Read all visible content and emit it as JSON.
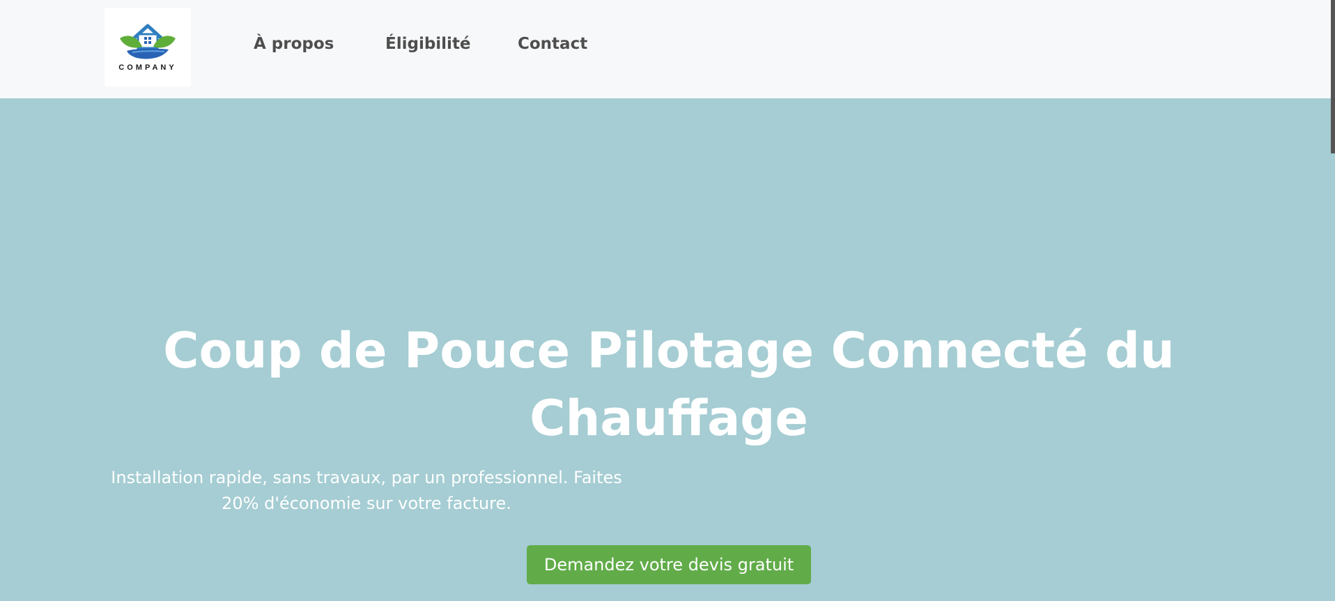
{
  "logo": {
    "text": "COMPANY",
    "icon": "house-leaves-hand-logo",
    "colors": {
      "roof": "#2f7fc0",
      "leaf": "#5fae3a",
      "hand": "#2a63b5"
    }
  },
  "nav": {
    "items": [
      {
        "label": "À propos"
      },
      {
        "label": "Éligibilité"
      },
      {
        "label": "Contact"
      }
    ]
  },
  "hero": {
    "title": "Coup de Pouce Pilotage Connecté du Chauffage",
    "subtitle": "Installation rapide, sans travaux, par un professionnel. Faites 20% d'économie sur votre facture.",
    "cta_label": "Demandez votre devis gratuit"
  },
  "colors": {
    "navbar_bg": "#f7f8fa",
    "hero_bg": "#a5cdd3",
    "cta_bg": "#61ac49",
    "nav_text": "#4e4e4e"
  }
}
